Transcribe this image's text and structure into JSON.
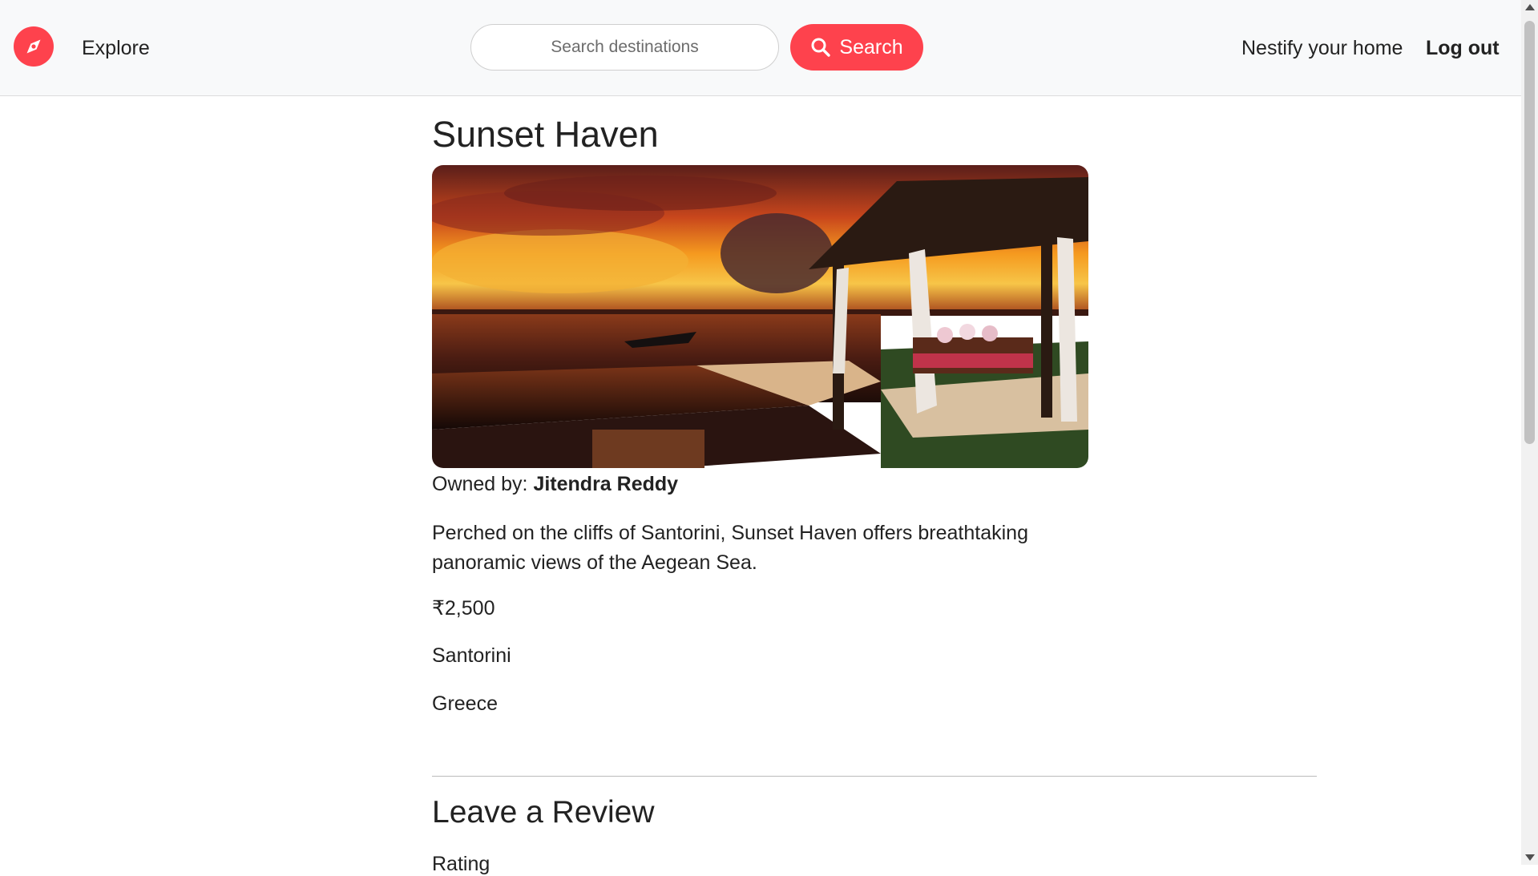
{
  "navbar": {
    "brand_icon": "compass-icon",
    "explore_label": "Explore",
    "search": {
      "placeholder": "Search destinations",
      "value": ""
    },
    "search_button_label": "Search",
    "search_icon": "search-icon",
    "host_label": "Nestify your home",
    "logout_label": "Log out"
  },
  "listing": {
    "title": "Sunset Haven",
    "owner_prefix": "Owned by: ",
    "owner_name": "Jitendra Reddy",
    "description": "Perched on the cliffs of Santorini, Sunset Haven offers breathtaking panoramic views of the Aegean Sea.",
    "price": "₹2,500",
    "location": "Santorini",
    "country": "Greece"
  },
  "review": {
    "heading": "Leave a Review",
    "rating_label": "Rating"
  },
  "colors": {
    "brand": "#fe424d",
    "navbar_bg": "#f8f9fa",
    "text": "#222222"
  }
}
